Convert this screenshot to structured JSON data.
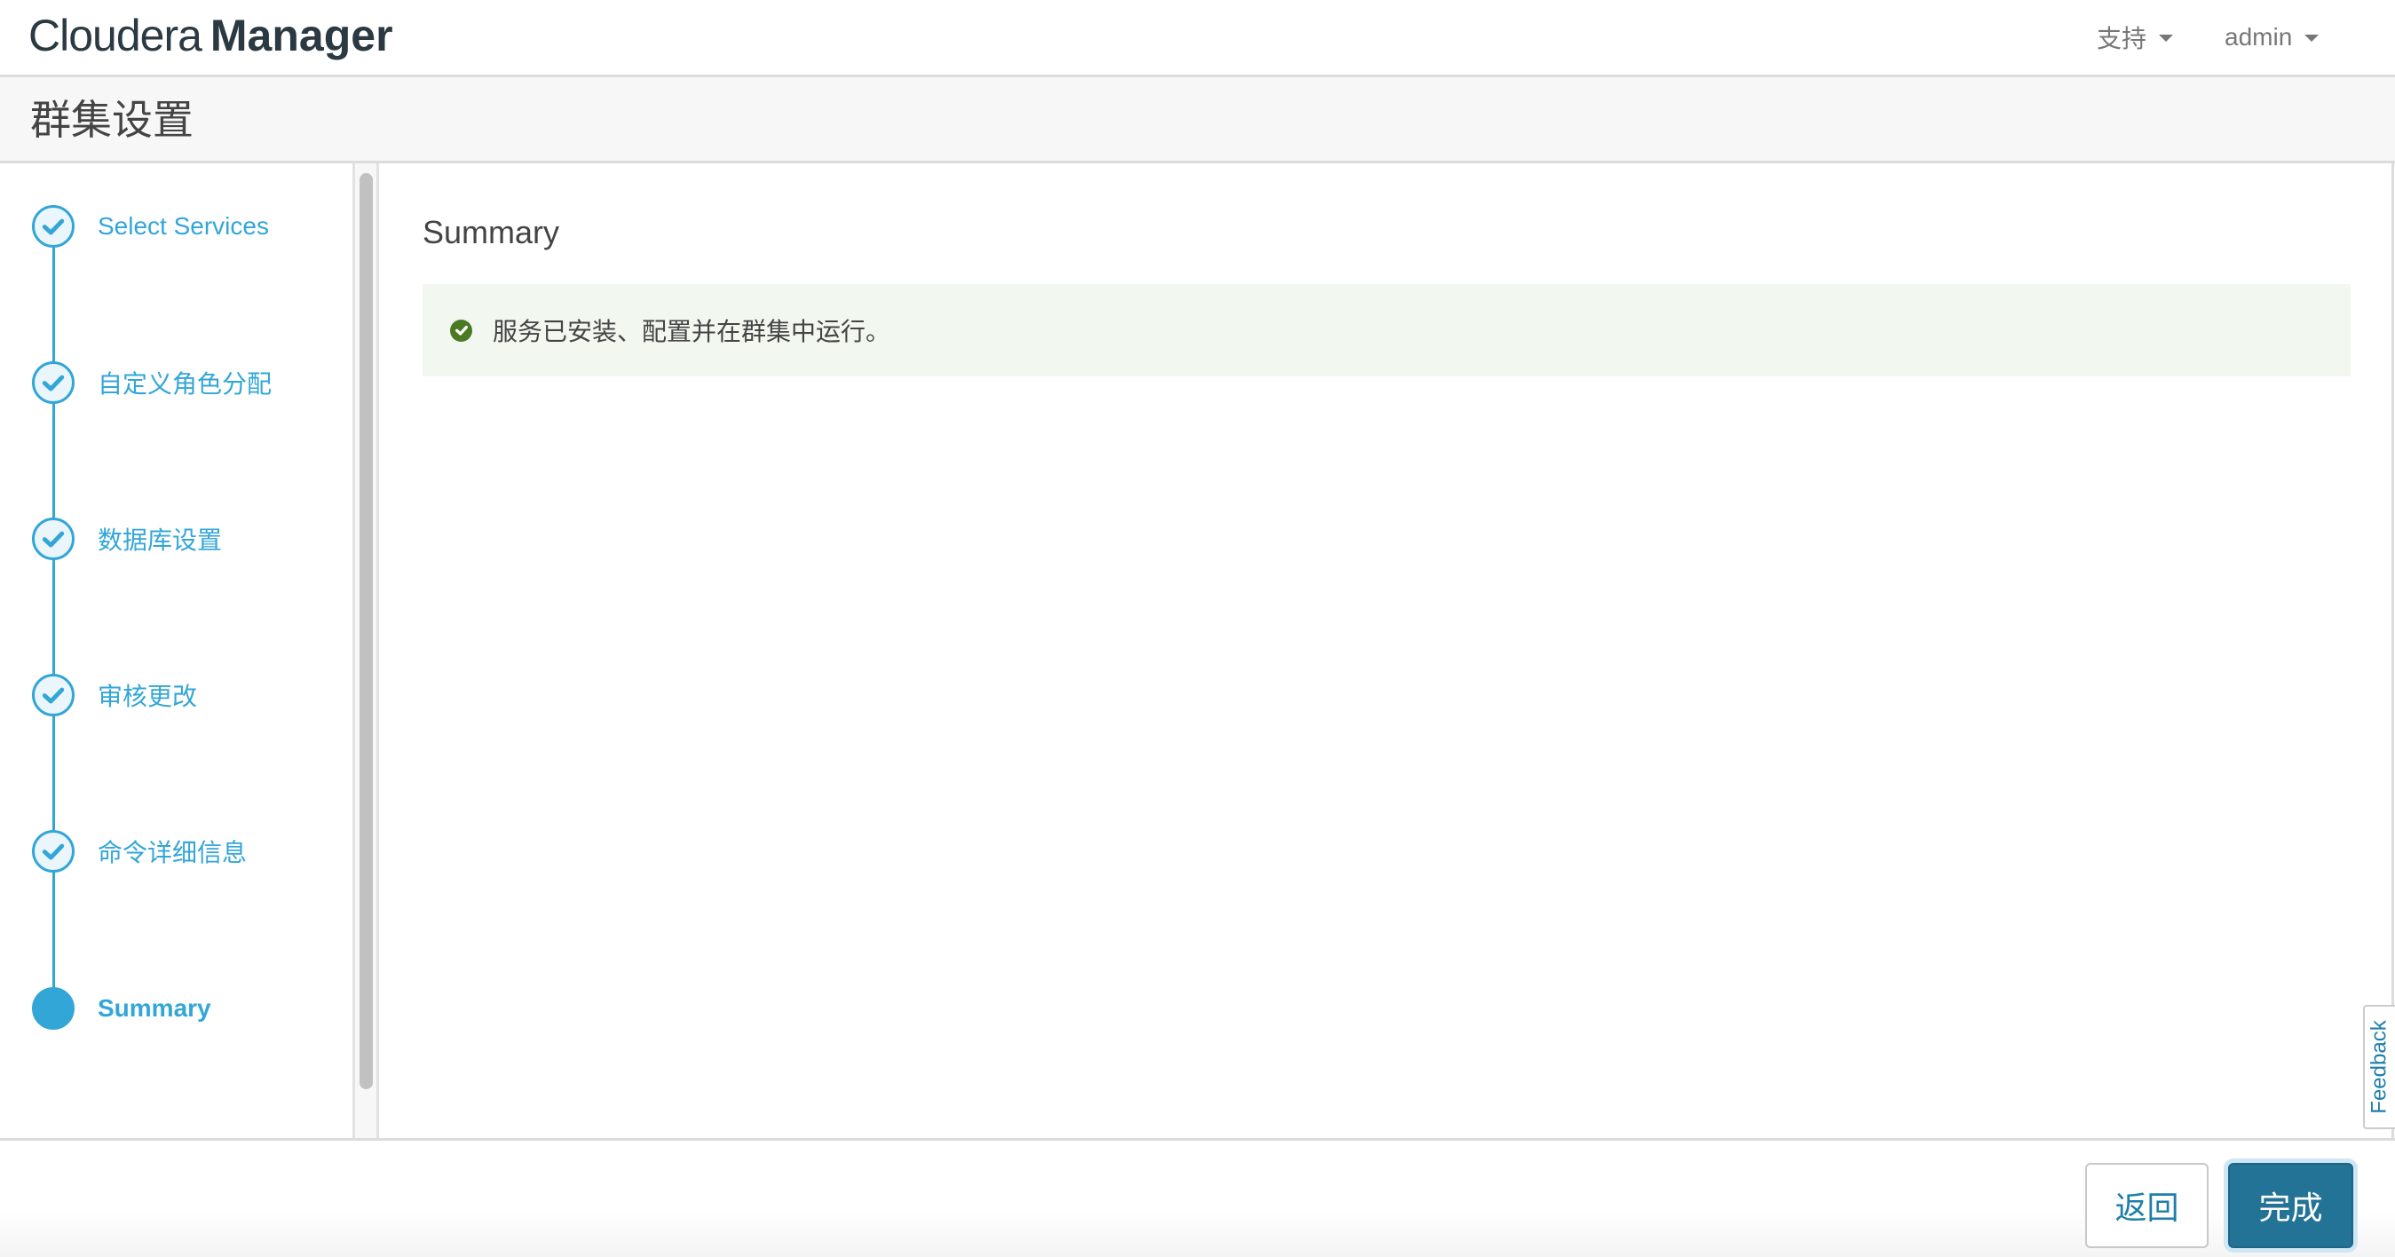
{
  "header": {
    "brand_light": "Cloudera",
    "brand_bold": "Manager",
    "menus": [
      {
        "label": "支持"
      },
      {
        "label": "admin"
      }
    ]
  },
  "page": {
    "title": "群集设置"
  },
  "wizard": {
    "steps": [
      {
        "label": "Select Services",
        "status": "completed"
      },
      {
        "label": "自定义角色分配",
        "status": "completed"
      },
      {
        "label": "数据库设置",
        "status": "completed"
      },
      {
        "label": "审核更改",
        "status": "completed"
      },
      {
        "label": "命令详细信息",
        "status": "completed"
      },
      {
        "label": "Summary",
        "status": "active"
      }
    ]
  },
  "main": {
    "heading": "Summary",
    "alert": {
      "type": "success",
      "icon": "check-circle-icon",
      "text": "服务已安装、配置并在群集中运行。"
    }
  },
  "feedback": {
    "label": "Feedback"
  },
  "footer": {
    "back_label": "返回",
    "finish_label": "完成"
  },
  "colors": {
    "accent": "#33a6d8",
    "primary_button": "#237397",
    "success_bg": "#f2f8ef",
    "success_icon": "#4a7a23"
  }
}
